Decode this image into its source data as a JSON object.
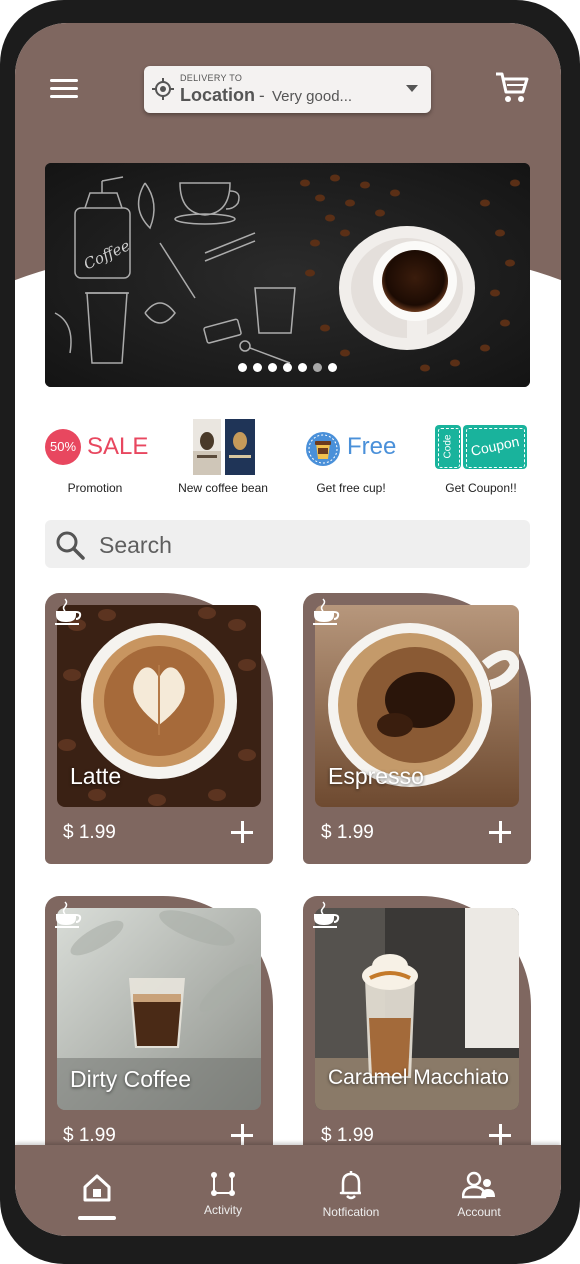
{
  "header": {
    "menu_icon": "hamburger-menu-icon",
    "location": {
      "small_label": "DELIVERY TO",
      "title": "Location",
      "separator": "-",
      "subtitle": "Very good..."
    },
    "cart_icon": "shopping-cart-icon"
  },
  "banner": {
    "dots_total": 7,
    "active_dot": 1
  },
  "promotions": [
    {
      "badge": "50%",
      "title": "SALE",
      "label": "Promotion"
    },
    {
      "label": "New coffee bean"
    },
    {
      "title": "Free",
      "label": "Get free cup!"
    },
    {
      "ticket_left": "Code",
      "ticket_right": "Coupon",
      "label": "Get Coupon!!"
    }
  ],
  "search": {
    "placeholder": "Search"
  },
  "products": [
    {
      "name": "Latte",
      "price": "$ 1.99"
    },
    {
      "name": "Espresso",
      "price": "$ 1.99"
    },
    {
      "name": "Dirty Coffee",
      "price": "$ 1.99"
    },
    {
      "name": "Caramel Macchiato",
      "price": "$ 1.99"
    }
  ],
  "tabbar": {
    "items": [
      {
        "label": "",
        "icon": "home-icon",
        "active": true
      },
      {
        "label": "Activity",
        "icon": "activity-icon"
      },
      {
        "label": "Notfication",
        "icon": "bell-icon"
      },
      {
        "label": "Account",
        "icon": "account-icon"
      }
    ]
  },
  "colors": {
    "brand": "#7f6760",
    "sale": "#e8475f",
    "free": "#4a90d9",
    "coupon": "#19b39c"
  }
}
